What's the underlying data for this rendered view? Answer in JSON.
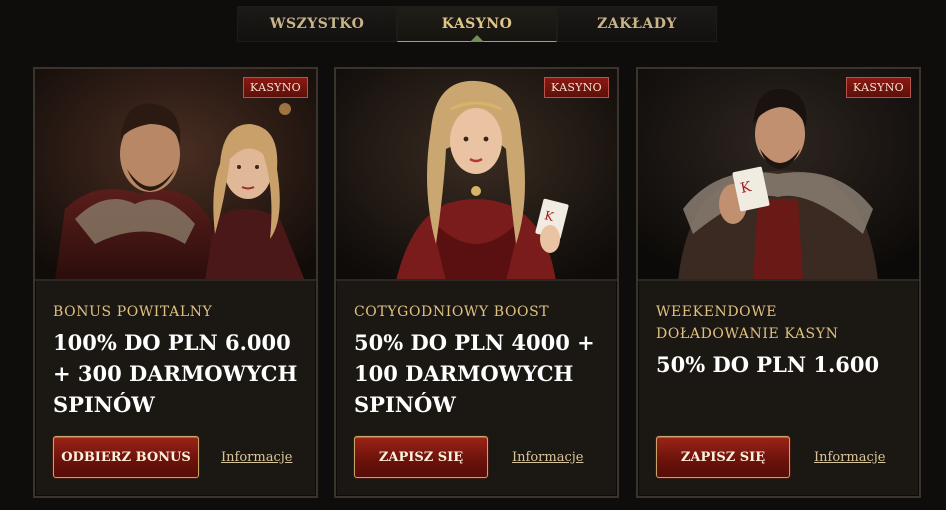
{
  "tabs": [
    {
      "label": "WSZYSTKO",
      "active": false
    },
    {
      "label": "KASYNO",
      "active": true
    },
    {
      "label": "ZAKŁADY",
      "active": false
    }
  ],
  "cards": [
    {
      "badge": "KASYNO",
      "subtitle": "BONUS POWITALNY",
      "headline": "100% DO PLN 6.000 + 300 DARMOWYCH SPINÓW",
      "cta": "ODBIERZ BONUS",
      "info": "Informacje"
    },
    {
      "badge": "KASYNO",
      "subtitle": "COTYGODNIOWY BOOST",
      "headline": "50% DO PLN 4000 + 100 DARMOWYCH SPINÓW",
      "cta": "ZAPISZ SIĘ",
      "info": "Informacje"
    },
    {
      "badge": "KASYNO",
      "subtitle": "WEEKENDOWE DOŁADOWANIE KASYN",
      "headline": "50% DO PLN 1.600",
      "cta": "ZAPISZ SIĘ",
      "info": "Informacje"
    }
  ],
  "colors": {
    "background": "#0f0d0b",
    "gold": "#e0c080",
    "cta_red": "#7a150d",
    "badge_red": "#7a160f"
  }
}
